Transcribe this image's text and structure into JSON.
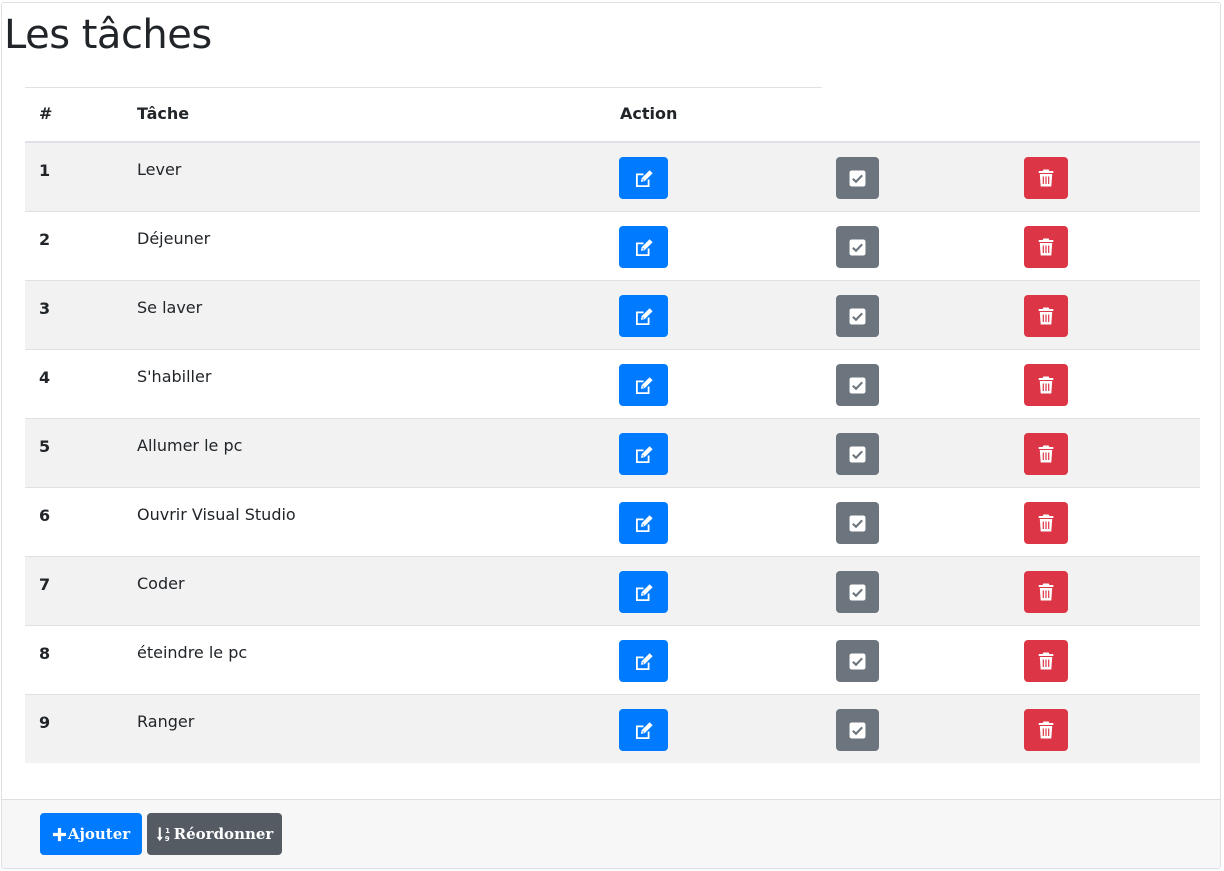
{
  "page": {
    "title": "Les tâches"
  },
  "table": {
    "headers": {
      "num": "#",
      "task": "Tâche",
      "action": "Action"
    },
    "rows": [
      {
        "num": "1",
        "task": "Lever"
      },
      {
        "num": "2",
        "task": "Déjeuner"
      },
      {
        "num": "3",
        "task": "Se laver"
      },
      {
        "num": "4",
        "task": "S'habiller"
      },
      {
        "num": "5",
        "task": "Allumer le pc"
      },
      {
        "num": "6",
        "task": "Ouvrir Visual Studio"
      },
      {
        "num": "7",
        "task": "Coder"
      },
      {
        "num": "8",
        "task": "éteindre le pc"
      },
      {
        "num": "9",
        "task": "Ranger"
      }
    ],
    "row_actions": [
      {
        "icon": "edit-icon",
        "color": "#007bff"
      },
      {
        "icon": "check-square-icon",
        "color": "#6c757d"
      },
      {
        "icon": "trash-icon",
        "color": "#dc3545"
      }
    ]
  },
  "footer": {
    "add_label": "Ajouter",
    "add_icon": "plus-icon",
    "add_color": "#007bff",
    "reorder_label": "Réordonner",
    "reorder_icon": "sort-numeric-down-icon",
    "reorder_color": "#545b62"
  }
}
